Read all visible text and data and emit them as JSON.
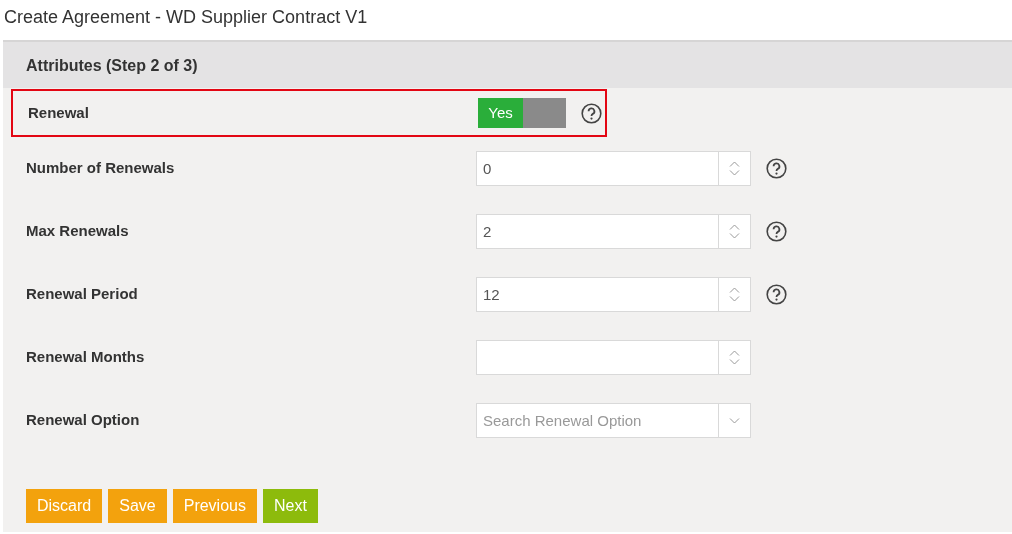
{
  "page_title": "Create Agreement - WD Supplier Contract V1",
  "panel": {
    "title": "Attributes (Step 2 of 3)",
    "fields": [
      {
        "kind": "toggle",
        "label": "Renewal",
        "on": true,
        "on_text": "Yes",
        "help": true,
        "highlighted": true
      },
      {
        "kind": "number",
        "label": "Number of Renewals",
        "value": "0",
        "help": true,
        "highlighted": false
      },
      {
        "kind": "number",
        "label": "Max Renewals",
        "value": "2",
        "help": true,
        "highlighted": false
      },
      {
        "kind": "number",
        "label": "Renewal Period",
        "value": "12",
        "help": true,
        "highlighted": false
      },
      {
        "kind": "number",
        "label": "Renewal Months",
        "help": false,
        "highlighted": false
      },
      {
        "kind": "select",
        "label": "Renewal Option",
        "placeholder": "Search Renewal Option",
        "help": false,
        "highlighted": false
      }
    ],
    "buttons": [
      {
        "label": "Discard",
        "color": "#f3a20d"
      },
      {
        "label": "Save",
        "color": "#f3a20d"
      },
      {
        "label": "Previous",
        "color": "#f3a20d"
      },
      {
        "label": "Next",
        "color": "#8dbb0c"
      }
    ]
  }
}
